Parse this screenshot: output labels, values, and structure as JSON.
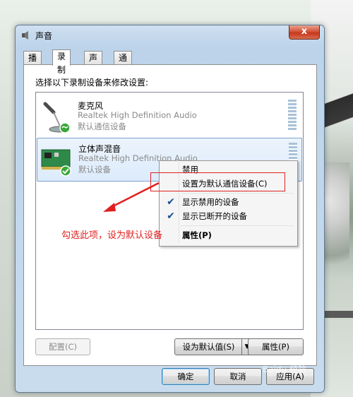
{
  "window": {
    "title": "声音",
    "close_label": "x"
  },
  "tabs": [
    {
      "label": "播放"
    },
    {
      "label": "录制"
    },
    {
      "label": "声音"
    },
    {
      "label": "通信"
    }
  ],
  "instruction": "选择以下录制设备来修改设置:",
  "devices": [
    {
      "name": "麦克风",
      "driver": "Realtek High Definition Audio",
      "status": "默认通信设备"
    },
    {
      "name": "立体声混音",
      "driver": "Realtek High Definition Audio",
      "status": "默认设备"
    }
  ],
  "context_menu": {
    "items": [
      {
        "label": "禁用"
      },
      {
        "label": "设置为默认通信设备(C)"
      },
      {
        "label": "显示禁用的设备"
      },
      {
        "label": "显示已断开的设备"
      },
      {
        "label": "属性(P)"
      }
    ]
  },
  "annotation": "勾选此项，设为默认设备",
  "buttons": {
    "configure": "配置(C)",
    "set_default": "设为默认值(S)",
    "properties": "属性(P)",
    "ok": "确定",
    "cancel": "取消",
    "apply": "应用(A)"
  },
  "watermark": "Baidu 经验",
  "colors": {
    "annotation": "#e02020",
    "selection": "#dcebfc",
    "accent": "#3c7fb1"
  }
}
